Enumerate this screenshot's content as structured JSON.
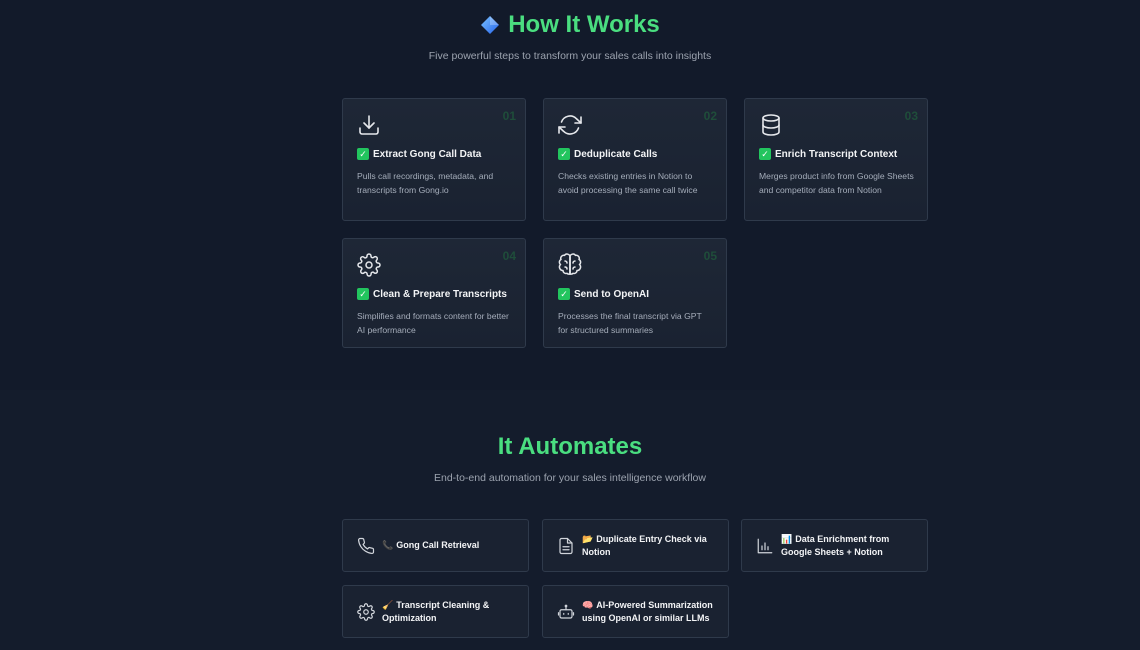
{
  "how_it_works": {
    "title": "How It Works",
    "subtitle": "Five powerful steps to transform your sales calls into insights",
    "icon": "blue-diamond-icon",
    "steps": [
      {
        "number": "01",
        "icon": "download-icon",
        "title": "Extract Gong Call Data",
        "description": "Pulls call recordings, metadata, and transcripts from Gong.io"
      },
      {
        "number": "02",
        "icon": "refresh-icon",
        "title": "Deduplicate Calls",
        "description": "Checks existing entries in Notion to avoid processing the same call twice"
      },
      {
        "number": "03",
        "icon": "database-icon",
        "title": "Enrich Transcript Context",
        "description": "Merges product info from Google Sheets and competitor data from Notion"
      },
      {
        "number": "04",
        "icon": "gear-icon",
        "title": "Clean & Prepare Transcripts",
        "description": "Simplifies and formats content for better AI performance"
      },
      {
        "number": "05",
        "icon": "brain-icon",
        "title": "Send to OpenAI",
        "description": "Processes the final transcript via GPT for structured summaries"
      }
    ]
  },
  "it_automates": {
    "title": "It Automates",
    "subtitle": "End-to-end automation for your sales intelligence workflow",
    "items": [
      {
        "icon": "phone-icon",
        "emoji": "📞",
        "label": "Gong Call Retrieval"
      },
      {
        "icon": "document-icon",
        "emoji": "📂",
        "label": "Duplicate Entry Check via Notion"
      },
      {
        "icon": "bar-chart-icon",
        "emoji": "📊",
        "label": "Data Enrichment from Google Sheets + Notion"
      },
      {
        "icon": "gear-icon",
        "emoji": "🧹",
        "label": "Transcript Cleaning & Optimization"
      },
      {
        "icon": "robot-icon",
        "emoji": "🧠",
        "label": "AI-Powered Summarization using OpenAI or similar LLMs"
      }
    ]
  },
  "colors": {
    "accent": "#4ade80",
    "background": "#111827",
    "card": "#1e2736",
    "check": "#22c55e"
  }
}
